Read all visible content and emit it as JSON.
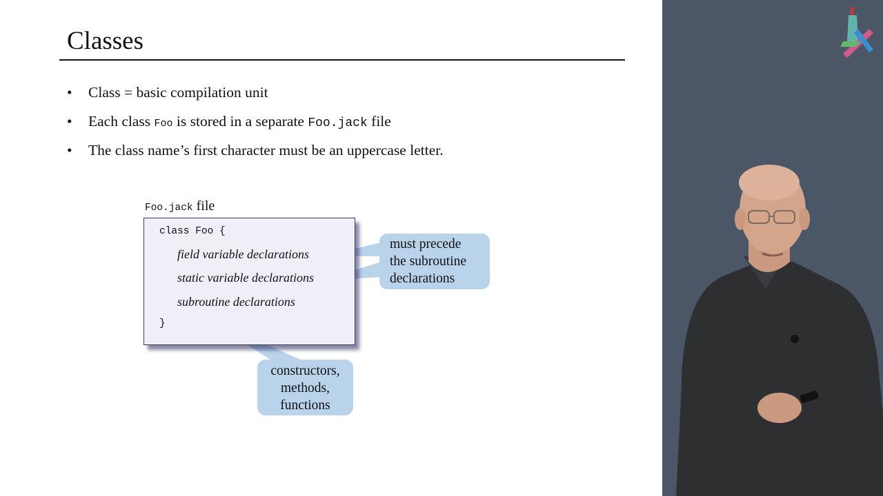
{
  "slide": {
    "title": "Classes",
    "bullets": [
      {
        "text": "Class = basic compilation unit"
      },
      {
        "pre": "Each class ",
        "code1": "Foo",
        "mid": " is stored in a separate ",
        "code2": "Foo.jack",
        "post": " file"
      },
      {
        "text": "The class name’s first character must be an uppercase letter."
      }
    ],
    "bullet_symbol": "•",
    "file_label": {
      "code": "Foo.jack",
      "text": " file"
    },
    "code": {
      "open": "class Foo {",
      "lines": [
        "field variable declarations",
        "static variable declarations",
        "subroutine declarations"
      ],
      "close": "}"
    },
    "callouts": {
      "precede": [
        "must precede",
        "the subroutine",
        "declarations"
      ],
      "subroutines": [
        "constructors,",
        "methods,",
        "functions"
      ]
    }
  },
  "colors": {
    "callout_fill": "#b9d3ea",
    "code_box_fill": "#f0eff8",
    "video_background": "#4b5667"
  },
  "video": {
    "logo_icon": "course-logo-icon",
    "presenter": "presenter-image"
  }
}
